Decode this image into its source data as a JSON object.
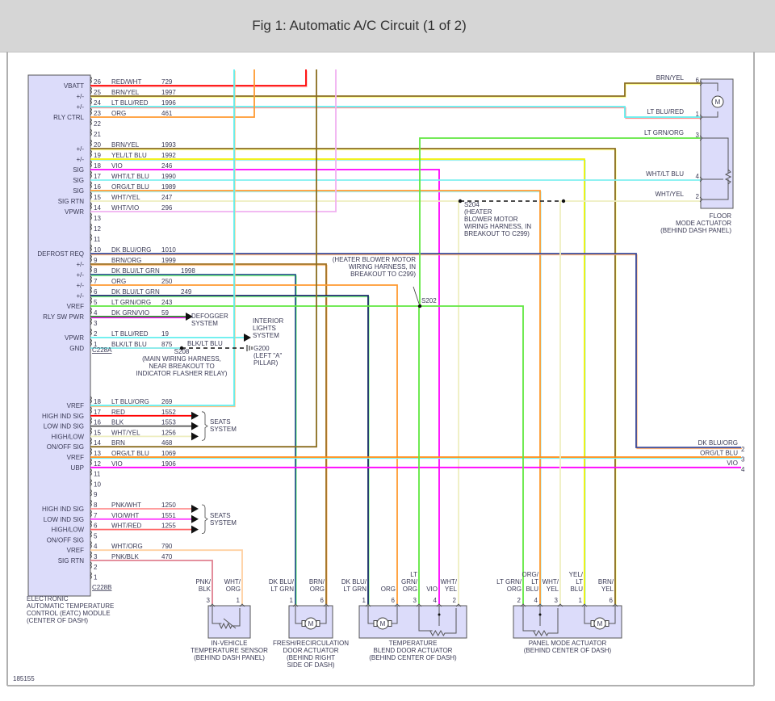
{
  "title": "Fig 1: Automatic A/C Circuit (1 of 2)",
  "figure_number": "185155",
  "module": {
    "label": [
      "ELECTRONIC",
      "AUTOMATIC TEMPERATURE",
      "CONTROL (EATC) MODULE",
      "(CENTER OF DASH)"
    ]
  },
  "connectors": [
    {
      "name": "C228A",
      "pins": [
        {
          "pin": "26",
          "function": "VBATT",
          "wire": "RED/WHT",
          "circuit": "729",
          "color": "#ff0000",
          "stripe": "#ffb0b0"
        },
        {
          "pin": "25",
          "function": "+/-",
          "wire": "BRN/YEL",
          "circuit": "1997",
          "color": "#8b6d1f",
          "stripe": "#ffff90"
        },
        {
          "pin": "24",
          "function": "+/-",
          "wire": "LT BLU/RED",
          "circuit": "1996",
          "color": "#60eeee",
          "stripe": "#ff9090"
        },
        {
          "pin": "23",
          "function": "RLY CTRL",
          "wire": "ORG",
          "circuit": "461",
          "color": "#ff9a30",
          "stripe": ""
        },
        {
          "pin": "22",
          "function": "",
          "wire": "",
          "circuit": "",
          "color": "",
          "stripe": ""
        },
        {
          "pin": "21",
          "function": "",
          "wire": "",
          "circuit": "",
          "color": "",
          "stripe": ""
        },
        {
          "pin": "20",
          "function": "+/-",
          "wire": "BRN/YEL",
          "circuit": "1993",
          "color": "#8b6d1f",
          "stripe": "#ffff90"
        },
        {
          "pin": "19",
          "function": "+/-",
          "wire": "YEL/LT BLU",
          "circuit": "1992",
          "color": "#f0f000",
          "stripe": "#a0f0f0"
        },
        {
          "pin": "18",
          "function": "SIG",
          "wire": "VIO",
          "circuit": "246",
          "color": "#ff00ff",
          "stripe": ""
        },
        {
          "pin": "17",
          "function": "SIG",
          "wire": "WHT/LT BLU",
          "circuit": "1990",
          "color": "#80f0f0",
          "stripe": ""
        },
        {
          "pin": "16",
          "function": "SIG",
          "wire": "ORG/LT BLU",
          "circuit": "1989",
          "color": "#ff9a30",
          "stripe": "#a0f0f0"
        },
        {
          "pin": "15",
          "function": "SIG RTN",
          "wire": "WHT/YEL",
          "circuit": "247",
          "color": "#eeeec0",
          "stripe": ""
        },
        {
          "pin": "14",
          "function": "VPWR",
          "wire": "WHT/VIO",
          "circuit": "296",
          "color": "#f0b0f0",
          "stripe": ""
        },
        {
          "pin": "13",
          "function": "",
          "wire": "",
          "circuit": "",
          "color": "",
          "stripe": ""
        },
        {
          "pin": "12",
          "function": "",
          "wire": "",
          "circuit": "",
          "color": "",
          "stripe": ""
        },
        {
          "pin": "11",
          "function": "",
          "wire": "",
          "circuit": "",
          "color": "",
          "stripe": ""
        },
        {
          "pin": "10",
          "function": "DEFROST REQ",
          "wire": "DK BLU/ORG",
          "circuit": "1010",
          "color": "#3a4a9a",
          "stripe": "#ffb070"
        },
        {
          "pin": "9",
          "function": "+/-",
          "wire": "BRN/ORG",
          "circuit": "1999",
          "color": "#a07020",
          "stripe": "#ffc080"
        },
        {
          "pin": "8",
          "function": "+/-",
          "wire": "DK BLU/LT GRN",
          "circuit": "1998",
          "color": "#2a5a8a",
          "stripe": "#80ff80"
        },
        {
          "pin": "7",
          "function": "+/-",
          "wire": "ORG",
          "circuit": "250",
          "color": "#ff9a30",
          "stripe": ""
        },
        {
          "pin": "6",
          "function": "+/-",
          "wire": "DK BLU/LT GRN",
          "circuit": "249",
          "color": "#1a2a6a",
          "stripe": "#80ff80"
        },
        {
          "pin": "5",
          "function": "VREF",
          "wire": "LT GRN/ORG",
          "circuit": "243",
          "color": "#60e840",
          "stripe": ""
        },
        {
          "pin": "4",
          "function": "RLY SW PWR",
          "wire": "DK GRN/VIO",
          "circuit": "59",
          "color": "#2a7a2a",
          "stripe": "#ff00ff"
        },
        {
          "pin": "3",
          "function": "",
          "wire": "",
          "circuit": "",
          "color": "",
          "stripe": ""
        },
        {
          "pin": "2",
          "function": "VPWR",
          "wire": "LT BLU/RED",
          "circuit": "19",
          "color": "#60eeee",
          "stripe": ""
        },
        {
          "pin": "1",
          "function": "GND",
          "wire": "BLK/LT BLU",
          "circuit": "875",
          "color": "#80e8e8",
          "stripe": ""
        }
      ]
    },
    {
      "name": "C228B",
      "pins": [
        {
          "pin": "18",
          "function": "VREF",
          "wire": "LT BLU/ORG",
          "circuit": "269",
          "color": "#60eeee",
          "stripe": "#ffc080"
        },
        {
          "pin": "17",
          "function": "HIGH IND SIG",
          "wire": "RED",
          "circuit": "1552",
          "color": "#ff0000",
          "stripe": ""
        },
        {
          "pin": "16",
          "function": "LOW IND SIG",
          "wire": "BLK",
          "circuit": "1553",
          "color": "#555555",
          "stripe": ""
        },
        {
          "pin": "15",
          "function": "HIGH/LOW",
          "wire": "WHT/YEL",
          "circuit": "1256",
          "color": "#eeeec0",
          "stripe": ""
        },
        {
          "pin": "14",
          "function": "ON/OFF SIG",
          "wire": "BRN",
          "circuit": "468",
          "color": "#8b6d1f",
          "stripe": ""
        },
        {
          "pin": "13",
          "function": "VREF",
          "wire": "ORG/LT BLU",
          "circuit": "1069",
          "color": "#ff8a10",
          "stripe": "#80f0f0"
        },
        {
          "pin": "12",
          "function": "UBP",
          "wire": "VIO",
          "circuit": "1906",
          "color": "#ff00ff",
          "stripe": ""
        },
        {
          "pin": "11",
          "function": "",
          "wire": "",
          "circuit": "",
          "color": "",
          "stripe": ""
        },
        {
          "pin": "10",
          "function": "",
          "wire": "",
          "circuit": "",
          "color": "",
          "stripe": ""
        },
        {
          "pin": "9",
          "function": "",
          "wire": "",
          "circuit": "",
          "color": "",
          "stripe": ""
        },
        {
          "pin": "8",
          "function": "HIGH IND SIG",
          "wire": "PNK/WHT",
          "circuit": "1250",
          "color": "#ff9090",
          "stripe": ""
        },
        {
          "pin": "7",
          "function": "LOW IND SIG",
          "wire": "VIO/WHT",
          "circuit": "1551",
          "color": "#ff40ff",
          "stripe": ""
        },
        {
          "pin": "6",
          "function": "HIGH/LOW",
          "wire": "WHT/RED",
          "circuit": "1255",
          "color": "#ff6060",
          "stripe": ""
        },
        {
          "pin": "5",
          "function": "ON/OFF SIG",
          "wire": "",
          "circuit": "",
          "color": "",
          "stripe": ""
        },
        {
          "pin": "4",
          "function": "VREF",
          "wire": "WHT/ORG",
          "circuit": "790",
          "color": "#ffd0a0",
          "stripe": ""
        },
        {
          "pin": "3",
          "function": "SIG RTN",
          "wire": "PNK/BLK",
          "circuit": "470",
          "color": "#e08090",
          "stripe": ""
        },
        {
          "pin": "2",
          "function": "",
          "wire": "",
          "circuit": "",
          "color": "",
          "stripe": ""
        },
        {
          "pin": "1",
          "function": "",
          "wire": "",
          "circuit": "",
          "color": "",
          "stripe": ""
        }
      ]
    }
  ],
  "destinations": {
    "defogger": [
      "DEFOGGER",
      "SYSTEM"
    ],
    "interior_lights": [
      "INTERIOR",
      "LIGHTS",
      "SYSTEM"
    ],
    "seats_1": [
      "SEATS",
      "SYSTEM"
    ],
    "seats_2": [
      "SEATS",
      "SYSTEM"
    ],
    "ground_wire": "BLK/LT BLU",
    "ground": [
      "G200",
      "(LEFT \"A\"",
      "PILLAR)"
    ],
    "s208": [
      "S208",
      "(MAIN WIRING HARNESS,",
      "NEAR BREAKOUT TO",
      "INDICATOR FLASHER RELAY)"
    ],
    "s204": [
      "S204",
      "(HEATER",
      "BLOWER MOTOR",
      "WIRING HARNESS, IN",
      "BREAKOUT TO C299)"
    ],
    "s202_note": [
      "(HEATER BLOWER MOTOR",
      "WIRING HARNESS, IN",
      "BREAKOUT TO C299)"
    ],
    "s202": "S202",
    "continued": [
      {
        "wire": "DK BLU/ORG",
        "pin": "2"
      },
      {
        "wire": "ORG/LT BLU",
        "pin": "3"
      },
      {
        "wire": "VIO",
        "pin": "4"
      }
    ]
  },
  "components": {
    "floor": {
      "label": [
        "FLOOR",
        "MODE ACTUATOR",
        "(BEHIND DASH PANEL)"
      ],
      "pins": [
        {
          "pin": "6",
          "wire": "BRN/YEL"
        },
        {
          "pin": "1",
          "wire": "LT BLU/RED"
        },
        {
          "pin": "3",
          "wire": "LT GRN/ORG"
        },
        {
          "pin": "4",
          "wire": "WHT/LT BLU"
        },
        {
          "pin": "2",
          "wire": "WHT/YEL"
        }
      ]
    },
    "sensor": {
      "label": [
        "IN-VEHICLE",
        "TEMPERATURE SENSOR",
        "(BEHIND DASH PANEL)"
      ],
      "pins": [
        {
          "pin": "3",
          "wire": [
            "PNK/",
            "BLK"
          ]
        },
        {
          "pin": "1",
          "wire": [
            "WHT/",
            "ORG"
          ]
        }
      ]
    },
    "fresh": {
      "label": [
        "FRESH/RECIRCULATION",
        "DOOR ACTUATOR",
        "(BEHIND RIGHT",
        "SIDE OF DASH)"
      ],
      "pins": [
        {
          "pin": "1",
          "wire": [
            "DK BLU/",
            "LT GRN"
          ]
        },
        {
          "pin": "6",
          "wire": [
            "BRN/",
            "ORG"
          ]
        }
      ]
    },
    "blend": {
      "label": [
        "TEMPERATURE",
        "BLEND DOOR ACTUATOR",
        "(BEHIND CENTER OF DASH)"
      ],
      "pins": [
        {
          "pin": "1",
          "wire": [
            "DK BLU/",
            "LT GRN"
          ]
        },
        {
          "pin": "6",
          "wire": [
            "ORG"
          ]
        },
        {
          "pin": "3",
          "wire": [
            "LT",
            "GRN/",
            "ORG"
          ]
        },
        {
          "pin": "4",
          "wire": [
            "VIO"
          ]
        },
        {
          "pin": "2",
          "wire": [
            "WHT/",
            "YEL"
          ]
        }
      ]
    },
    "panel": {
      "label": [
        "PANEL MODE ACTUATOR",
        "(BEHIND CENTER OF DASH)"
      ],
      "pins": [
        {
          "pin": "2",
          "wire": [
            "LT GRN/",
            "ORG"
          ]
        },
        {
          "pin": "4",
          "wire": [
            "ORG/",
            "LT",
            "BLU"
          ]
        },
        {
          "pin": "3",
          "wire": [
            "WHT/",
            "YEL"
          ]
        },
        {
          "pin": "1",
          "wire": [
            "YEL/",
            "LT",
            "BLU"
          ]
        },
        {
          "pin": "6",
          "wire": [
            "BRN/",
            "YEL"
          ]
        }
      ]
    },
    "motor_symbol": "M"
  }
}
